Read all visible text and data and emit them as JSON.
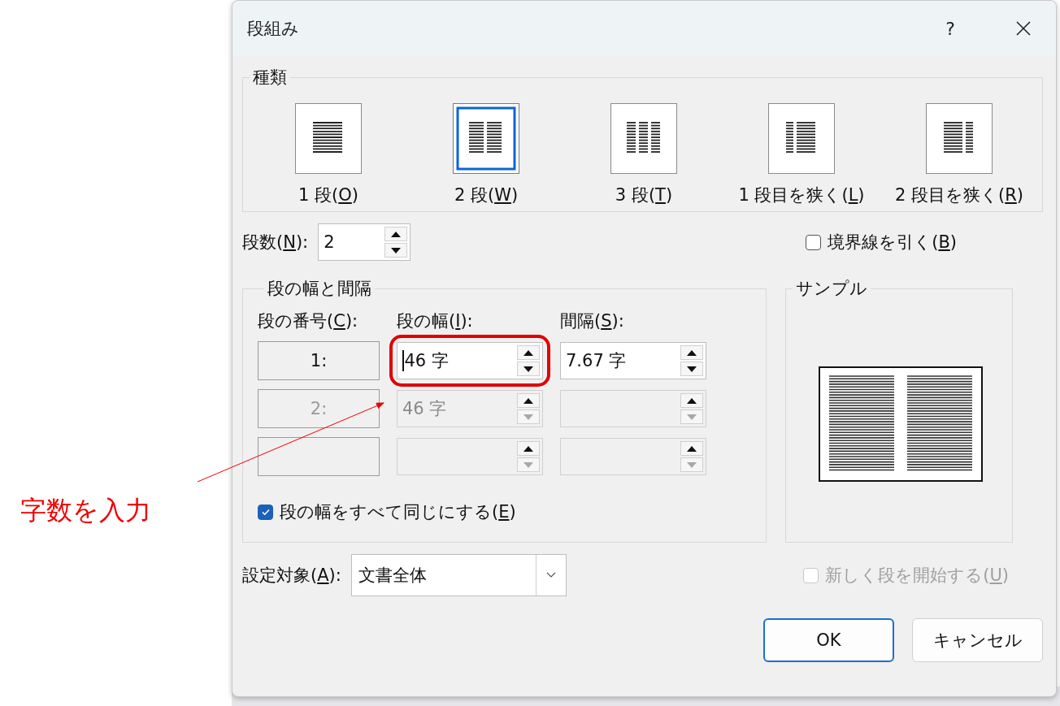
{
  "annotation": {
    "text": "字数を入力"
  },
  "dialog": {
    "title": "段組み",
    "help": "?"
  },
  "presets": {
    "label": "種類",
    "items": [
      {
        "kind": "one",
        "before": "1 段(",
        "key": "O",
        "after": ")",
        "selected": false
      },
      {
        "kind": "two",
        "before": "2 段(",
        "key": "W",
        "after": ")",
        "selected": true
      },
      {
        "kind": "three",
        "before": "3 段(",
        "key": "T",
        "after": ")",
        "selected": false
      },
      {
        "kind": "left",
        "before": "1 段目を狭く(",
        "key": "L",
        "after": ")",
        "selected": false
      },
      {
        "kind": "right",
        "before": "2 段目を狭く(",
        "key": "R",
        "after": ")",
        "selected": false
      }
    ]
  },
  "columns_count": {
    "before": "段数(",
    "key": "N",
    "after": "):",
    "value": "2"
  },
  "line_between": {
    "before": "境界線を引く(",
    "key": "B",
    "after": ")",
    "checked": false,
    "disabled": false
  },
  "width_spacing": {
    "label": "段の幅と間隔",
    "headers": [
      {
        "before": "段の番号(",
        "key": "C",
        "after": "):"
      },
      {
        "before": "段の幅(",
        "key": "I",
        "after": "):"
      },
      {
        "before": "間隔(",
        "key": "S",
        "after": "):"
      }
    ],
    "rows": [
      {
        "number": "1:",
        "disabled": false,
        "width": {
          "value": "46 字",
          "disabled": false,
          "focused": true,
          "highlighted": true
        },
        "spacing": {
          "value": "7.67 字",
          "disabled": false,
          "focused": false
        }
      },
      {
        "number": "2:",
        "disabled": true,
        "width": {
          "value": "46 字",
          "disabled": true,
          "focused": false,
          "highlighted": false
        },
        "spacing": {
          "disabled": true,
          "focused": false
        }
      },
      {
        "disabled": true,
        "width": {
          "disabled": true,
          "focused": false,
          "highlighted": false
        },
        "spacing": {
          "disabled": true,
          "focused": false
        }
      }
    ]
  },
  "equal_width": {
    "before": "段の幅をすべて同じにする(",
    "key": "E",
    "after": ")",
    "checked": true,
    "disabled": false
  },
  "sample": {
    "label": "サンプル"
  },
  "apply_to": {
    "before": "設定対象(",
    "key": "A",
    "after": "):",
    "value": "文書全体"
  },
  "start_new_column": {
    "before": "新しく段を開始する(",
    "key": "U",
    "after": ")",
    "checked": false,
    "disabled": true
  },
  "buttons": [
    {
      "label": "OK",
      "default": true
    },
    {
      "label": "キャンセル",
      "default": false
    }
  ]
}
